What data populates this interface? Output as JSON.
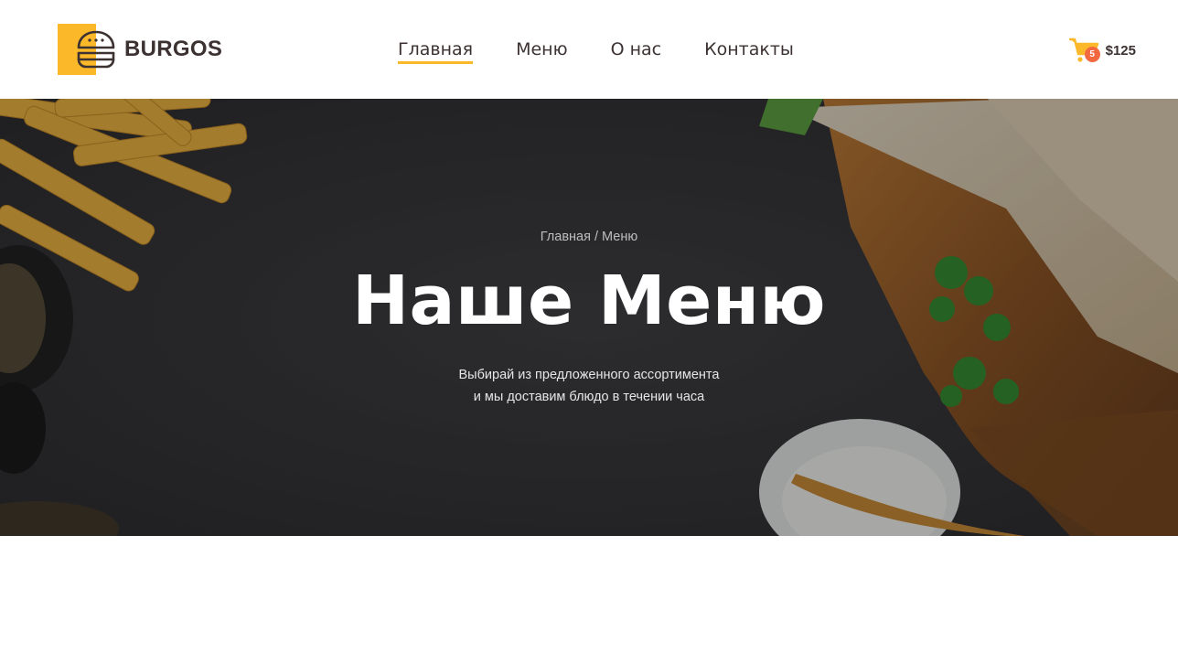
{
  "brand": {
    "name": "BURGOS",
    "icon": "burger-icon",
    "accent": "#fbb829"
  },
  "nav": {
    "items": [
      {
        "label": "Главная",
        "active": true
      },
      {
        "label": "Меню",
        "active": false
      },
      {
        "label": "О нас",
        "active": false
      },
      {
        "label": "Контакты",
        "active": false
      }
    ]
  },
  "cart": {
    "icon": "cart-icon",
    "count": "5",
    "total": "$125",
    "badge_color": "#f2683f"
  },
  "hero": {
    "breadcrumb": {
      "home": "Главная",
      "separator": "/",
      "current": "Меню"
    },
    "title": "Наше Меню",
    "subtitle_line1": "Выбирай из предложенного ассортимента",
    "subtitle_line2": "и мы доставим блюдо в течении часа"
  }
}
